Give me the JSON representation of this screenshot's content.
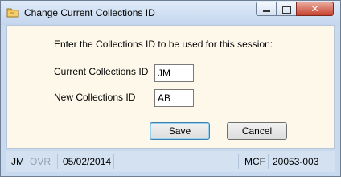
{
  "window": {
    "title": "Change Current Collections ID",
    "minimize_glyph": "",
    "close_glyph": "✕",
    "app_icon": "folder-icon"
  },
  "form": {
    "prompt": "Enter the Collections ID to be used for this session:",
    "current_label": "Current Collections ID",
    "current_value": "JM",
    "new_label": "New Collections ID",
    "new_value": "AB",
    "save_label": "Save",
    "cancel_label": "Cancel"
  },
  "status": {
    "user": "JM",
    "ovr": "OVR",
    "date": "05/02/2014",
    "mcf": "MCF",
    "code": "20053-003"
  }
}
